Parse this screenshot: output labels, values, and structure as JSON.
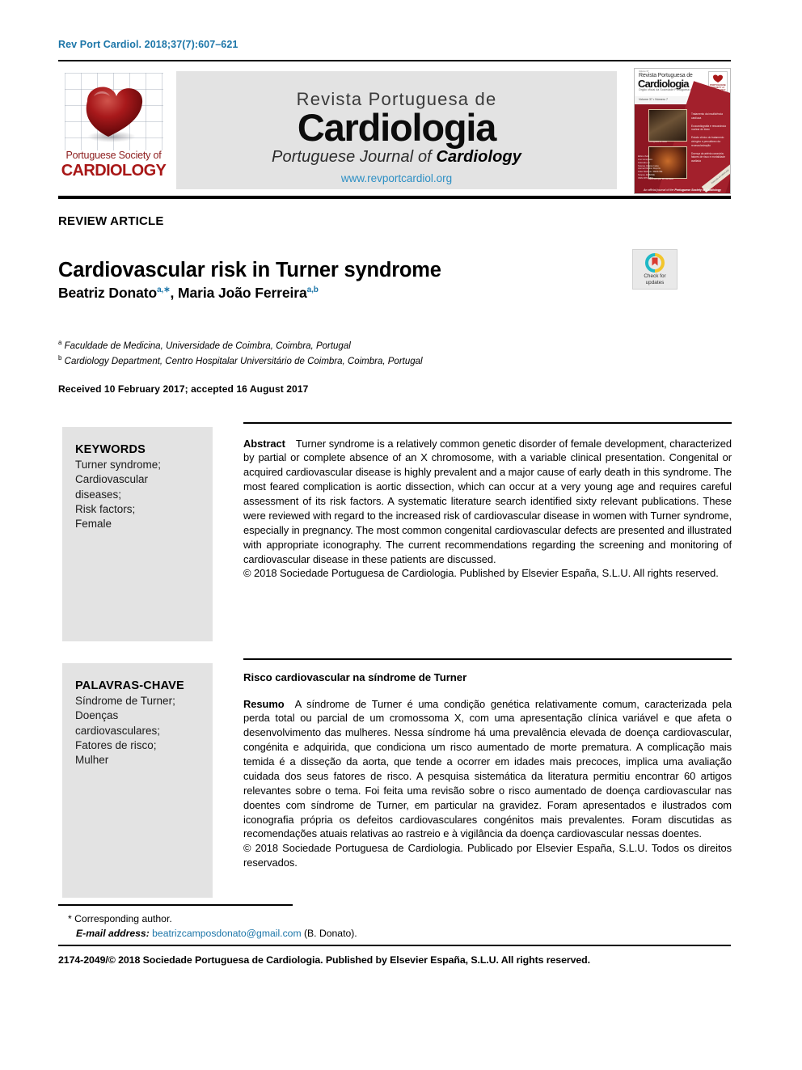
{
  "header": {
    "citation": "Rev Port Cardiol. 2018;37(7):607–621"
  },
  "masthead": {
    "society_line1": "Portuguese Society of",
    "society_line2": "CARDIOLOGY",
    "journal_line1": "Revista Portuguesa de",
    "journal_line2": "Cardiologia",
    "journal_line3_a": "Portuguese Journal of ",
    "journal_line3_b": "Cardiology",
    "website": "www.revportcardiol.org",
    "cover": {
      "tiny_tag": "Volume 37",
      "title_small": "Revista Portuguesa de",
      "title_big": "Cardiologia",
      "subtitle": "Orgão oficial da Sociedade Portuguesa de Cardiologia",
      "badge_line1": "PORTUGUESE SOCIETY of",
      "badge_line2": "CARDIOLOGY",
      "bar_left": "Volume 37 • Número 7",
      "bar_right": "Julho 2018",
      "caption1": "Tomografia de tórax",
      "caption2": "Reconstrução 3D cardíaca",
      "toc": [
        "Tratamento da insuficiência cardíaca",
        "Ecocardiografia e ressonância nuclear de tórax",
        "Estudo clínico do tratamento cirúrgico e percutâneo da revascularização",
        "Doença da artéria coronária: fatores de risco e mortalidade avaliada"
      ],
      "left_notes": [
        "Editor-chefe",
        "Lino Gonçalves",
        "Revista Portuguesa de Cardiologia",
        "www.revportcardiol.org",
        "Indexada em",
        "Science Citation Index",
        "Journal Citation Reports",
        "Index Medicus / MEDLINE",
        "Scopus, EMBASE",
        "ISSN 0870-2551"
      ],
      "footer_a": "An official journal of the ",
      "footer_b": "Portuguese Society of Cardiology",
      "corner": "Indexada em MEDLINE"
    }
  },
  "article": {
    "kicker": "REVIEW ARTICLE",
    "title": "Cardiovascular risk in Turner syndrome",
    "authors": [
      {
        "name": "Beatriz Donato",
        "marks": "a,∗"
      },
      {
        "name": "Maria João Ferreira",
        "marks": "a,b"
      }
    ],
    "affiliations": [
      {
        "mark": "a",
        "text": "Faculdade de Medicina, Universidade de Coimbra, Coimbra, Portugal"
      },
      {
        "mark": "b",
        "text": "Cardiology Department, Centro Hospitalar Universitário de Coimbra, Coimbra, Portugal"
      }
    ],
    "history": "Received 10 February 2017; accepted 16 August 2017"
  },
  "crossmark": {
    "line1": "Check for",
    "line2": "updates"
  },
  "english": {
    "keywords_heading": "KEYWORDS",
    "keywords": "Turner syndrome;\nCardiovascular\ndiseases;\nRisk factors;\nFemale",
    "abstract_label": "Abstract",
    "abstract_text": "Turner syndrome is a relatively common genetic disorder of female development, characterized by partial or complete absence of an X chromosome, with a variable clinical presentation. Congenital or acquired cardiovascular disease is highly prevalent and a major cause of early death in this syndrome. The most feared complication is aortic dissection, which can occur at a very young age and requires careful assessment of its risk factors. A systematic literature search identified sixty relevant publications. These were reviewed with regard to the increased risk of cardiovascular disease in women with Turner syndrome, especially in pregnancy. The most common congenital cardiovascular defects are presented and illustrated with appropriate iconography. The current recommendations regarding the screening and monitoring of cardiovascular disease in these patients are discussed.",
    "copyright": "© 2018 Sociedade Portuguesa de Cardiologia. Published by Elsevier España, S.L.U. All rights reserved."
  },
  "portuguese": {
    "keywords_heading": "PALAVRAS-CHAVE",
    "keywords": "Síndrome de Turner;\nDoenças\ncardiovasculares;\nFatores de risco;\nMulher",
    "title": "Risco cardiovascular na síndrome de Turner",
    "abstract_label": "Resumo",
    "abstract_text": "A síndrome de Turner é uma condição genética relativamente comum, caracterizada pela perda total ou parcial de um cromossoma X, com uma apresentação clínica variável e que afeta o desenvolvimento das mulheres. Nessa síndrome há uma prevalência elevada de doença cardiovascular, congénita e adquirida, que condiciona um risco aumentado de morte prematura. A complicação mais temida é a disseção da aorta, que tende a ocorrer em idades mais precoces, implica uma avaliação cuidada dos seus fatores de risco. A pesquisa sistemática da literatura permitiu encontrar 60 artigos relevantes sobre o tema. Foi feita uma revisão sobre o risco aumentado de doença cardiovascular nas doentes com síndrome de Turner, em particular na gravidez. Foram apresentados e ilustrados com iconografia própria os defeitos cardiovasculares congénitos mais prevalentes. Foram discutidas as recomendações atuais relativas ao rastreio e à vigilância da doença cardiovascular nessas doentes.",
    "copyright": "© 2018 Sociedade Portuguesa de Cardiologia. Publicado por Elsevier España, S.L.U. Todos os direitos reservados."
  },
  "footnotes": {
    "corresponding": "* Corresponding author.",
    "email_label": "E-mail address:",
    "email": "beatrizcamposdonato@gmail.com",
    "email_suffix": "(B. Donato)."
  },
  "footer": {
    "issn_line": "2174-2049/© 2018 Sociedade Portuguesa de Cardiologia. Published by Elsevier España, S.L.U. All rights reserved."
  },
  "colors": {
    "link": "#1b75a8",
    "masthead_bg": "#e3e3e3",
    "heart_red": "#a81717"
  }
}
